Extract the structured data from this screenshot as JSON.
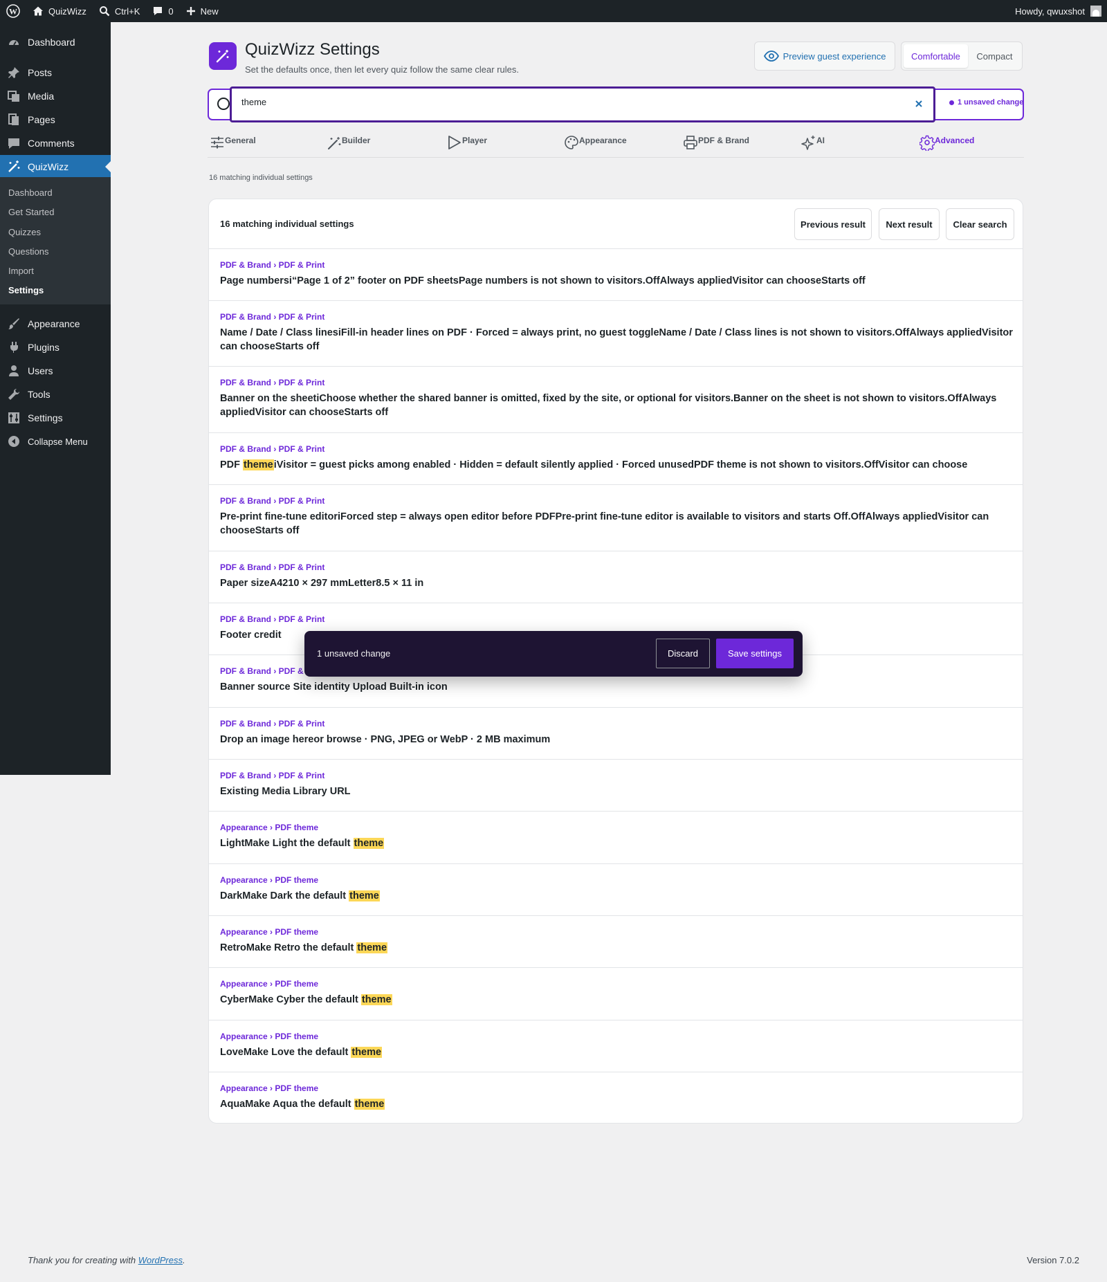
{
  "adminbar": {
    "site_name": "QuizWizz",
    "search_shortcut": "Ctrl+K",
    "comments_count": "0",
    "new_label": "New",
    "greeting": "Howdy, qwuxshot"
  },
  "sidebar": {
    "items": [
      {
        "label": "Dashboard",
        "icon": "dashboard-icon"
      },
      {
        "label": "Posts",
        "icon": "pin-icon"
      },
      {
        "label": "Media",
        "icon": "media-icon"
      },
      {
        "label": "Pages",
        "icon": "pages-icon"
      },
      {
        "label": "Comments",
        "icon": "comment-icon"
      },
      {
        "label": "QuizWizz",
        "icon": "magic-wand-icon"
      },
      {
        "label": "Appearance",
        "icon": "brush-icon"
      },
      {
        "label": "Plugins",
        "icon": "plugin-icon"
      },
      {
        "label": "Users",
        "icon": "user-icon"
      },
      {
        "label": "Tools",
        "icon": "wrench-icon"
      },
      {
        "label": "Settings",
        "icon": "settings-icon"
      }
    ],
    "submenu": [
      "Dashboard",
      "Get Started",
      "Quizzes",
      "Questions",
      "Import",
      "Settings"
    ],
    "collapse_label": "Collapse Menu"
  },
  "header": {
    "title": "QuizWizz Settings",
    "subtitle": "Set the defaults once, then let every quiz follow the same clear rules.",
    "preview_label": "Preview guest experience",
    "density_options": [
      "Comfortable",
      "Compact"
    ],
    "density_selected": "Comfortable"
  },
  "search": {
    "value": "theme",
    "unsaved_pill": "1 unsaved change"
  },
  "tabs": [
    {
      "label": "General",
      "icon": "sliders-icon"
    },
    {
      "label": "Builder",
      "icon": "wand-icon"
    },
    {
      "label": "Player",
      "icon": "play-icon"
    },
    {
      "label": "Appearance",
      "icon": "palette-icon"
    },
    {
      "label": "PDF & Brand",
      "icon": "printer-icon"
    },
    {
      "label": "AI",
      "icon": "sparkles-icon"
    },
    {
      "label": "Advanced",
      "icon": "gear-icon"
    }
  ],
  "results": {
    "summary_small": "16 matching individual settings",
    "summary": "16 matching individual settings",
    "prev_label": "Previous result",
    "next_label": "Next result",
    "clear_label": "Clear search",
    "items": [
      {
        "crumb": "PDF & Brand › PDF & Print",
        "text": "Page numbersi“Page 1 of 2” footer on PDF sheetsPage numbers is not shown to visitors.OffAlways appliedVisitor can chooseStarts off"
      },
      {
        "crumb": "PDF & Brand › PDF & Print",
        "text": "Name / Date / Class linesiFill-in header lines on PDF · Forced = always print, no guest toggleName / Date / Class lines is not shown to visitors.OffAlways appliedVisitor can chooseStarts off"
      },
      {
        "crumb": "PDF & Brand › PDF & Print",
        "text": "Banner on the sheetiChoose whether the shared banner is omitted, fixed by the site, or optional for visitors.Banner on the sheet is not shown to visitors.OffAlways appliedVisitor can chooseStarts off"
      },
      {
        "crumb": "PDF & Brand › PDF & Print",
        "pre": "PDF ",
        "hl": "theme",
        "post": "iVisitor = guest picks among enabled · Hidden = default silently applied · Forced unusedPDF theme is not shown to visitors.OffVisitor can choose"
      },
      {
        "crumb": "PDF & Brand › PDF & Print",
        "text": "Pre-print fine-tune editoriForced step = always open editor before PDFPre-print fine-tune editor is available to visitors and starts Off.OffAlways appliedVisitor can chooseStarts off"
      },
      {
        "crumb": "PDF & Brand › PDF & Print",
        "text": "Paper sizeA4210 × 297 mmLetter8.5 × 11 in"
      },
      {
        "crumb": "PDF & Brand › PDF & Print",
        "text": "Footer credit"
      },
      {
        "crumb": "PDF & Brand › PDF & Print",
        "text": "Banner source Site identity Upload Built-in icon"
      },
      {
        "crumb": "PDF & Brand › PDF & Print",
        "text": "Drop an image hereor browse · PNG, JPEG or WebP · 2 MB maximum"
      },
      {
        "crumb": "PDF & Brand › PDF & Print",
        "text": "Existing Media Library URL"
      },
      {
        "crumb": "Appearance › PDF theme",
        "pre": "LightMake Light the default ",
        "hl": "theme",
        "post": ""
      },
      {
        "crumb": "Appearance › PDF theme",
        "pre": "DarkMake Dark the default ",
        "hl": "theme",
        "post": ""
      },
      {
        "crumb": "Appearance › PDF theme",
        "pre": "RetroMake Retro the default ",
        "hl": "theme",
        "post": ""
      },
      {
        "crumb": "Appearance › PDF theme",
        "pre": "CyberMake Cyber the default ",
        "hl": "theme",
        "post": ""
      },
      {
        "crumb": "Appearance › PDF theme",
        "pre": "LoveMake Love the default ",
        "hl": "theme",
        "post": ""
      },
      {
        "crumb": "Appearance › PDF theme",
        "pre": "AquaMake Aqua the default ",
        "hl": "theme",
        "post": ""
      }
    ]
  },
  "toast": {
    "text": "1 unsaved change",
    "discard_label": "Discard",
    "save_label": "Save settings"
  },
  "footer": {
    "thanks_prefix": "Thank you for creating with ",
    "thanks_link": "WordPress",
    "thanks_suffix": ".",
    "version": "Version 7.0.2"
  },
  "colors": {
    "accent": "#6d28d9",
    "admin_dark": "#1d2327",
    "wp_blue": "#2271b1",
    "highlight": "#fcd757"
  }
}
